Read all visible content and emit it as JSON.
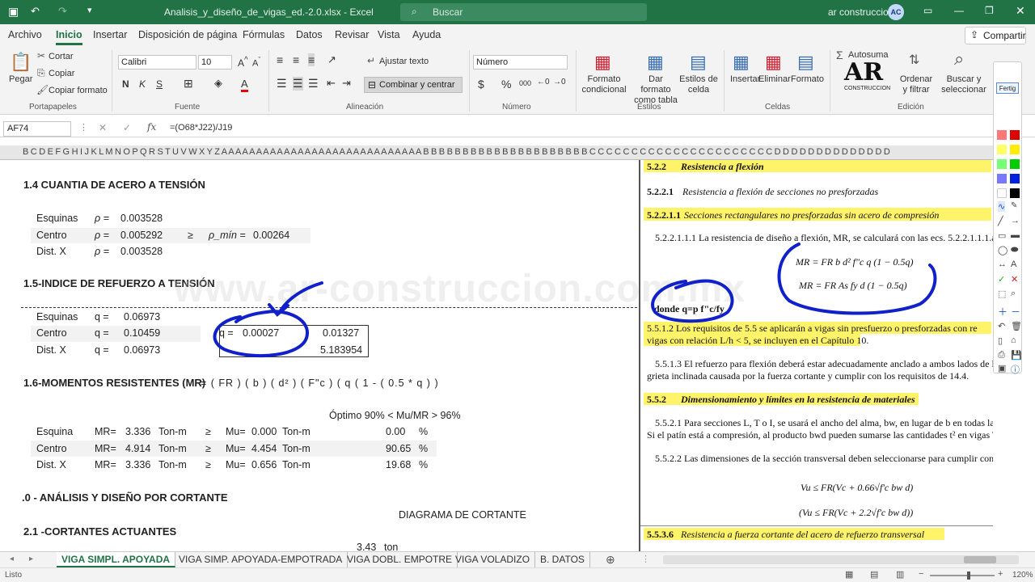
{
  "window": {
    "title": "Analisis_y_diseño_de_vigas_ed.-2.0.xlsx - Excel",
    "search_placeholder": "Buscar",
    "user_name": "ar construccion",
    "avatar_initials": "AC"
  },
  "menu": {
    "tabs": [
      "Archivo",
      "Inicio",
      "Insertar",
      "Disposición de página",
      "Fórmulas",
      "Datos",
      "Revisar",
      "Vista",
      "Ayuda"
    ],
    "active": "Inicio",
    "share_label": "Compartir"
  },
  "ribbon": {
    "clipboard": {
      "paste": "Pegar",
      "cut": "Cortar",
      "copy": "Copiar",
      "format_painter": "Copiar formato",
      "group": "Portapapeles"
    },
    "font": {
      "name": "Calibri",
      "size": "10",
      "group": "Fuente"
    },
    "alignment": {
      "wrap": "Ajustar texto",
      "merge": "Combinar y centrar",
      "group": "Alineación"
    },
    "number": {
      "format": "Número",
      "group": "Número"
    },
    "styles": {
      "conditional": "Formato condicional",
      "as_table": "Dar formato como tabla",
      "cell_styles": "Estilos de celda",
      "group": "Estilos"
    },
    "cells": {
      "insert": "Insertar",
      "delete": "Eliminar",
      "format": "Formato",
      "group": "Celdas"
    },
    "editing": {
      "autosum": "Autosuma",
      "sort": "Ordenar y filtrar",
      "find": "Buscar y seleccionar",
      "group": "Edición"
    }
  },
  "formula_bar": {
    "name_box": "AF74",
    "formula": "=(O68*J22)/J19"
  },
  "column_header": "B C D E F G H I J K L M N O P Q R S T U V W X Y Z A A A A A A A A A A A A A A A A A A A A A A A A A A A A A B B B B B B B B B B B B B B B B B B B B B C C C C C C C C C C C C C C C C C C C C C C D D D D D D D D D D D D D D",
  "rows": [
    "64",
    "65",
    "66",
    "67",
    "68",
    "69",
    "70",
    "71",
    "72",
    "73",
    "74",
    "75",
    "76",
    "77",
    "78",
    "79",
    "80",
    "81",
    "82",
    "83",
    "84",
    "85",
    "86",
    "87"
  ],
  "sheet": {
    "sec14": "1.4 CUANTIA DE ACERO A TENSIÓN",
    "rho_rows": [
      {
        "label": "Esquinas",
        "sym": "ρ =",
        "val": "0.003528"
      },
      {
        "label": "Centro",
        "sym": "ρ =",
        "val": "0.005292"
      },
      {
        "label": "Dist. X",
        "sym": "ρ =",
        "val": "0.003528"
      }
    ],
    "rho_min": {
      "ge": "≥",
      "label": "ρ_mín =",
      "val": "0.00264"
    },
    "sec15": "1.5-INDICE DE REFUERZO A TENSIÓN",
    "q_rows": [
      {
        "label": "Esquinas",
        "sym": "q =",
        "val": "0.06973"
      },
      {
        "label": "Centro",
        "sym": "q =",
        "val": "0.10459"
      },
      {
        "label": "Dist. X",
        "sym": "q =",
        "val": "0.06973"
      }
    ],
    "q_box": {
      "label": "q =",
      "val": "0.00027",
      "v2": "0.01327",
      "v3": "5.183954"
    },
    "sec16": "1.6-MOMENTOS RESISTENTES (MR)",
    "sec16_formula": "=  ( FR )  ( b )  ( d² )  ( F\"c )  ( q  ( 1  - ( 0.5 * q ) )",
    "optimo": "Óptimo 90% < Mu/MR > 96%",
    "m_rows": [
      {
        "label": "Esquina",
        "mr": "MR=",
        "mrv": "3.336",
        "unit": "Ton-m",
        "ge": "≥",
        "mu": "Mu=",
        "muv": "0.000",
        "unit2": "Ton-m",
        "pct": "0.00",
        "ps": "%"
      },
      {
        "label": "Centro",
        "mr": "MR=",
        "mrv": "4.914",
        "unit": "Ton-m",
        "ge": "≥",
        "mu": "Mu=",
        "muv": "4.454",
        "unit2": "Ton-m",
        "pct": "90.65",
        "ps": "%"
      },
      {
        "label": "Dist. X",
        "mr": "MR=",
        "mrv": "3.336",
        "unit": "Ton-m",
        "ge": "≥",
        "mu": "Mu=",
        "muv": "0.656",
        "unit2": "Ton-m",
        "pct": "19.68",
        "ps": "%"
      }
    ],
    "sec20": ".0 - ANÁLISIS Y DISEÑO POR CORTANTE",
    "diagram": "DIAGRAMA DE CORTANTE",
    "sec21": "2.1 -CORTANTES ACTUANTES",
    "v_val": "3.43",
    "v_unit": "ton",
    "watermark": "www.ar-construccion.com.mx"
  },
  "doc": {
    "h522_num": "5.2.2",
    "h522": "Resistencia a flexión",
    "h5221_num": "5.2.2.1",
    "h5221": "Resistencia a flexión de secciones no presforzadas",
    "h52211_num": "5.2.2.1.1",
    "h52211": "Secciones rectangulares no presforzadas sin acero de compresión",
    "p1": "5.2.2.1.1.1 La resistencia de diseño a flexión, MR, se calculará con las ecs. 5.2.2.1.1.1.a o",
    "eq1": "MR = FR b d² f\"c q (1 − 0.5q)",
    "eq2": "MR = FR As fy d (1 − 0.5q)",
    "donde": "donde q=p f\"c/fy",
    "p2": "5.5.1.2 Los requisitos de 5.5 se aplicarán a vigas sin presfuerzo o presforzadas con re",
    "p2b": "vigas con relación L/h < 5, se incluyen en el Capítulo 10.",
    "p3": "5.5.1.3 El refuerzo para flexión deberá estar adecuadamente anclado a ambos lados de lo",
    "p3b": "grieta inclinada causada por la fuerza cortante y cumplir con los requisitos de 14.4.",
    "h552_num": "5.5.2",
    "h552": "Dimensionamiento y límites en la resistencia de materiales",
    "p4": "5.5.2.1 Para secciones L, T o I, se usará el ancho del alma, bw, en lugar de b en todas las ecuacio",
    "p4b": "Si el patín está a compresión, al producto bwd pueden sumarse las cantidades t² en vigas T e I, y",
    "p5": "5.5.2.2 Las dimensiones de la sección transversal deben seleccionarse para cumplir con la ec. 5",
    "eq3": "Vu ≤ FR(Vc + 0.66√f'c bw d)",
    "eq4": "(Vu ≤ FR(Vc + 2.2√f'c bw d))",
    "h5536_num": "5.5.3.6",
    "h5536": "Resistencia a fuerza cortante del acero de refuerzo transversal"
  },
  "palette": {
    "label": "Fertig"
  },
  "sheet_tabs": [
    "VIGA SIMPL. APOYADA",
    "VIGA SIMP. APOYADA-EMPOTRADA",
    "VIGA DOBL. EMPOTRE",
    "VIGA VOLADIZO",
    "B. DATOS"
  ],
  "status": {
    "mode": "Listo",
    "zoom": "120%"
  }
}
